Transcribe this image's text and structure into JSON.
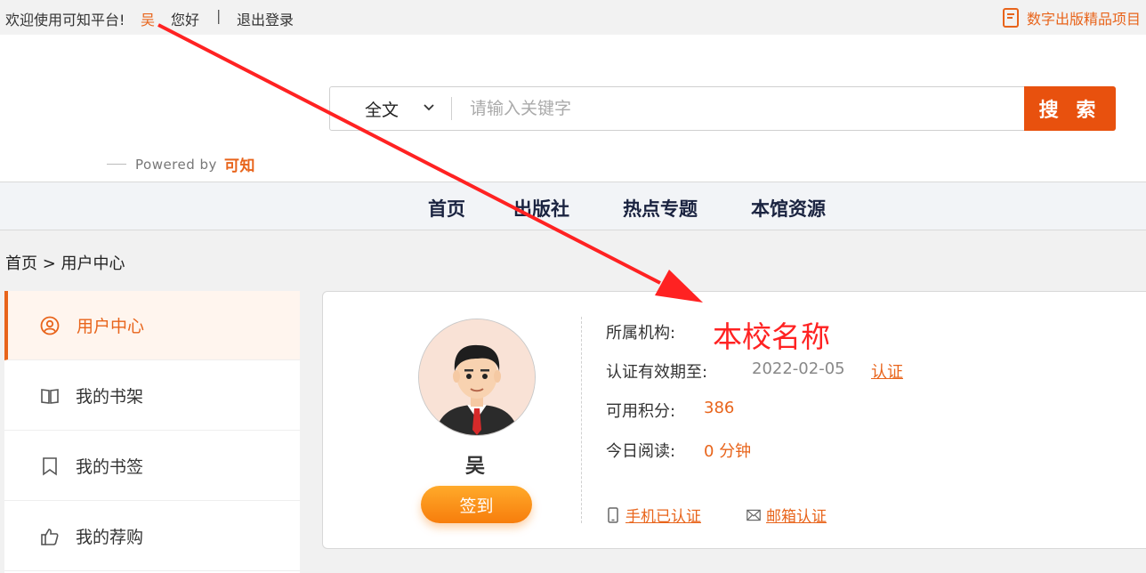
{
  "topbar": {
    "welcome": "欢迎使用可知平台!",
    "user_name": "吴",
    "hello": "您好",
    "separator": "|",
    "logout": "退出登录",
    "project_link": "数字出版精品项目"
  },
  "header": {
    "powered_by": "Powered by",
    "brand": "可知"
  },
  "search": {
    "scope_label": "全文",
    "placeholder": "请输入关键字",
    "button_label": "搜 索"
  },
  "nav": {
    "items": [
      "首页",
      "出版社",
      "热点专题",
      "本馆资源"
    ]
  },
  "breadcrumb": "首页 > 用户中心",
  "sidebar": {
    "items": [
      {
        "label": "用户中心",
        "icon": "user-circle-icon",
        "active": true
      },
      {
        "label": "我的书架",
        "icon": "open-book-icon",
        "active": false
      },
      {
        "label": "我的书签",
        "icon": "bookmark-icon",
        "active": false
      },
      {
        "label": "我的荐购",
        "icon": "thumbs-up-icon",
        "active": false
      }
    ]
  },
  "profile": {
    "name": "吴",
    "signin_label": "签到",
    "institution_label": "所属机构:",
    "institution_value": "本校名称",
    "cert_expiry_label": "认证有效期至:",
    "cert_expiry_value": "2022-02-05",
    "cert_link": "认证",
    "points_label": "可用积分:",
    "points_value": "386",
    "reading_label": "今日阅读:",
    "reading_value": "0 分钟",
    "phone_verify": "手机已认证",
    "email_verify": "邮箱认证"
  },
  "colors": {
    "accent": "#e8641b",
    "search_button": "#e8510e",
    "annotation": "#f22"
  }
}
